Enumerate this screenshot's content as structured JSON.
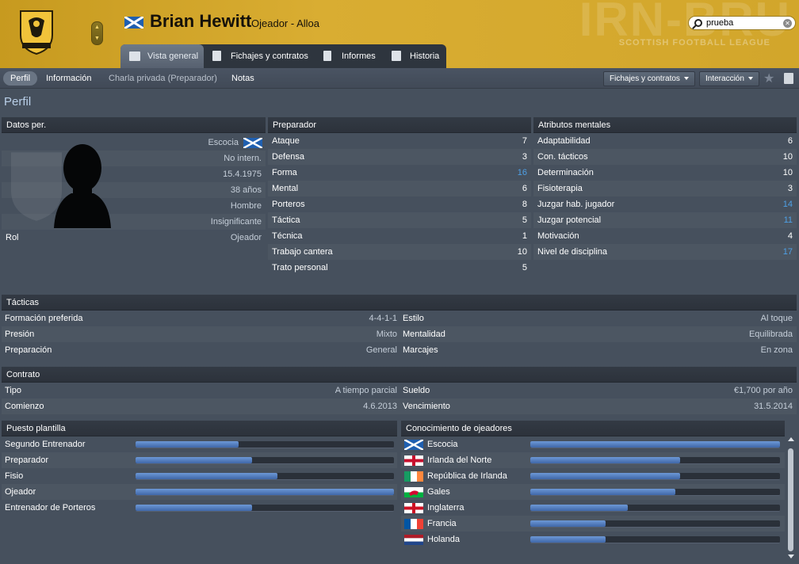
{
  "header": {
    "player_name": "Brian Hewitt",
    "player_role": "Ojeador - Alloa",
    "club_crest_text": "ALLOA ATHLETIC FC",
    "league_watermark": "SCOTTISH FOOTBALL LEAGUE",
    "search": {
      "value": "prueba",
      "placeholder": ""
    }
  },
  "tabs": [
    {
      "label": "Vista general",
      "active": true,
      "icon": "overview-icon"
    },
    {
      "label": "Fichajes y contratos",
      "active": false,
      "icon": "document-icon"
    },
    {
      "label": "Informes",
      "active": false,
      "icon": "report-icon"
    },
    {
      "label": "Historia",
      "active": false,
      "icon": "history-icon"
    }
  ],
  "subtabs": [
    {
      "label": "Perfil",
      "active": true
    },
    {
      "label": "Información",
      "active": false
    },
    {
      "label": "Charla privada (Preparador)",
      "active": false,
      "disabled": true
    },
    {
      "label": "Notas",
      "active": false
    }
  ],
  "toolbar": {
    "transfers_label": "Fichajes y contratos",
    "interaction_label": "Interacción"
  },
  "page_title": "Perfil",
  "personal": {
    "title": "Datos per.",
    "nationality": "Escocia",
    "intl": "No intern.",
    "dob": "15.4.1975",
    "age": "38 años",
    "gender": "Hombre",
    "reputation": "Insignificante",
    "role_label": "Rol",
    "role_value": "Ojeador"
  },
  "coach": {
    "title": "Preparador",
    "rows": [
      {
        "label": "Ataque",
        "value": "7",
        "hi": false
      },
      {
        "label": "Defensa",
        "value": "3",
        "hi": false
      },
      {
        "label": "Forma",
        "value": "16",
        "hi": true
      },
      {
        "label": "Mental",
        "value": "6",
        "hi": false
      },
      {
        "label": "Porteros",
        "value": "8",
        "hi": false
      },
      {
        "label": "Táctica",
        "value": "5",
        "hi": false
      },
      {
        "label": "Técnica",
        "value": "1",
        "hi": false
      },
      {
        "label": "Trabajo cantera",
        "value": "10",
        "hi": false
      },
      {
        "label": "Trato personal",
        "value": "5",
        "hi": false
      }
    ]
  },
  "mental": {
    "title": "Atributos mentales",
    "rows": [
      {
        "label": "Adaptabilidad",
        "value": "6",
        "hi": false
      },
      {
        "label": "Con. tácticos",
        "value": "10",
        "hi": false
      },
      {
        "label": "Determinación",
        "value": "10",
        "hi": false
      },
      {
        "label": "Fisioterapia",
        "value": "3",
        "hi": false
      },
      {
        "label": "Juzgar hab. jugador",
        "value": "14",
        "hi": true
      },
      {
        "label": "Juzgar potencial",
        "value": "11",
        "hi": true
      },
      {
        "label": "Motivación",
        "value": "4",
        "hi": false
      },
      {
        "label": "Nivel de disciplina",
        "value": "17",
        "hi": true
      }
    ]
  },
  "tactics": {
    "title": "Tácticas",
    "rows": [
      [
        {
          "label": "Formación preferida",
          "value": "4-4-1-1"
        },
        {
          "label": "Estilo",
          "value": "Al toque"
        }
      ],
      [
        {
          "label": "Presión",
          "value": "Mixto"
        },
        {
          "label": "Mentalidad",
          "value": "Equilibrada"
        }
      ],
      [
        {
          "label": "Preparación",
          "value": "General"
        },
        {
          "label": "Marcajes",
          "value": "En zona"
        }
      ]
    ]
  },
  "contract": {
    "title": "Contrato",
    "rows": [
      [
        {
          "label": "Tipo",
          "value": "A tiempo parcial"
        },
        {
          "label": "Sueldo",
          "value": "€1,700 por año"
        }
      ],
      [
        {
          "label": "Comienzo",
          "value": "4.6.2013"
        },
        {
          "label": "Vencimiento",
          "value": "31.5.2014"
        }
      ]
    ]
  },
  "staff_roles": {
    "title": "Puesto plantilla",
    "rows": [
      {
        "label": "Segundo Entrenador",
        "level": 0.4
      },
      {
        "label": "Preparador",
        "level": 0.45
      },
      {
        "label": "Fisio",
        "level": 0.55
      },
      {
        "label": "Ojeador",
        "level": 1.0
      },
      {
        "label": "Entrenador de Porteros",
        "level": 0.45
      }
    ]
  },
  "knowledge": {
    "title": "Conocimiento de ojeadores",
    "rows": [
      {
        "country": "Escocia",
        "flag": "scotland",
        "level": 1.0
      },
      {
        "country": "Irlanda del Norte",
        "flag": "northern-ireland",
        "level": 0.6
      },
      {
        "country": "República de Irlanda",
        "flag": "ireland",
        "level": 0.6
      },
      {
        "country": "Gales",
        "flag": "wales",
        "level": 0.58
      },
      {
        "country": "Inglaterra",
        "flag": "england",
        "level": 0.39
      },
      {
        "country": "Francia",
        "flag": "france",
        "level": 0.3
      },
      {
        "country": "Holanda",
        "flag": "netherlands",
        "level": 0.3
      }
    ]
  },
  "colors": {
    "accent": "#d4a72c",
    "value_highlight": "#4ea0e6",
    "bar_fill": "#4f78bd"
  }
}
